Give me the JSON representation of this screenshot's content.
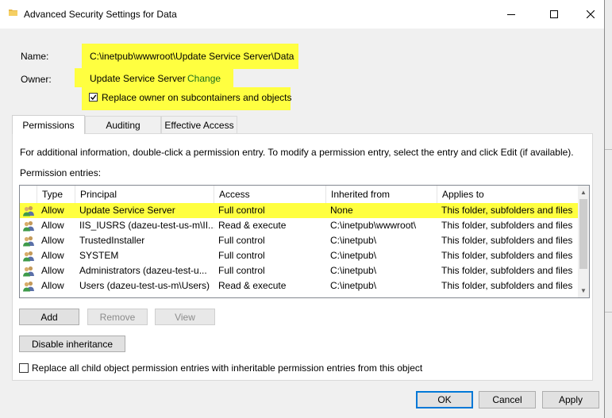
{
  "window": {
    "title": "Advanced Security Settings for Data",
    "controls": {
      "minimize": "—",
      "maximize": "☐",
      "close": "✕"
    }
  },
  "name": {
    "label": "Name:",
    "value": "C:\\inetpub\\wwwroot\\Update Service Server\\Data"
  },
  "owner": {
    "label": "Owner:",
    "value": "Update Service Server",
    "change_link": "Change"
  },
  "replace_owner": {
    "label": "Replace owner on subcontainers and objects",
    "checked": true,
    "mark": "✓"
  },
  "tabs": [
    {
      "label": "Permissions",
      "active": true
    },
    {
      "label": "Auditing",
      "active": false
    },
    {
      "label": "Effective Access",
      "active": false
    }
  ],
  "info_text": "For additional information, double-click a permission entry. To modify a permission entry, select the entry and click Edit (if available).",
  "entries_label": "Permission entries:",
  "columns": [
    "Type",
    "Principal",
    "Access",
    "Inherited from",
    "Applies to"
  ],
  "entries": [
    {
      "type": "Allow",
      "principal": "Update Service Server",
      "access": "Full control",
      "inherited": "None",
      "applies": "This folder, subfolders and files",
      "highlighted": true
    },
    {
      "type": "Allow",
      "principal": "IIS_IUSRS (dazeu-test-us-m\\II...",
      "access": "Read & execute",
      "inherited": "C:\\inetpub\\wwwroot\\",
      "applies": "This folder, subfolders and files",
      "highlighted": false
    },
    {
      "type": "Allow",
      "principal": "TrustedInstaller",
      "access": "Full control",
      "inherited": "C:\\inetpub\\",
      "applies": "This folder, subfolders and files",
      "highlighted": false
    },
    {
      "type": "Allow",
      "principal": "SYSTEM",
      "access": "Full control",
      "inherited": "C:\\inetpub\\",
      "applies": "This folder, subfolders and files",
      "highlighted": false
    },
    {
      "type": "Allow",
      "principal": "Administrators (dazeu-test-u...",
      "access": "Full control",
      "inherited": "C:\\inetpub\\",
      "applies": "This folder, subfolders and files",
      "highlighted": false
    },
    {
      "type": "Allow",
      "principal": "Users (dazeu-test-us-m\\Users)",
      "access": "Read & execute",
      "inherited": "C:\\inetpub\\",
      "applies": "This folder, subfolders and files",
      "highlighted": false
    }
  ],
  "scroll": {
    "up": "▲",
    "down": "▼"
  },
  "buttons": {
    "add": "Add",
    "remove": "Remove",
    "view": "View",
    "disable_inheritance": "Disable inheritance",
    "ok": "OK",
    "cancel": "Cancel",
    "apply": "Apply"
  },
  "replace_all": {
    "label": "Replace all child object permission entries with inheritable permission entries from this object",
    "checked": false
  },
  "colors": {
    "highlight": "#ffff40",
    "link": "#1b6e1b",
    "focus": "#0078d7"
  }
}
